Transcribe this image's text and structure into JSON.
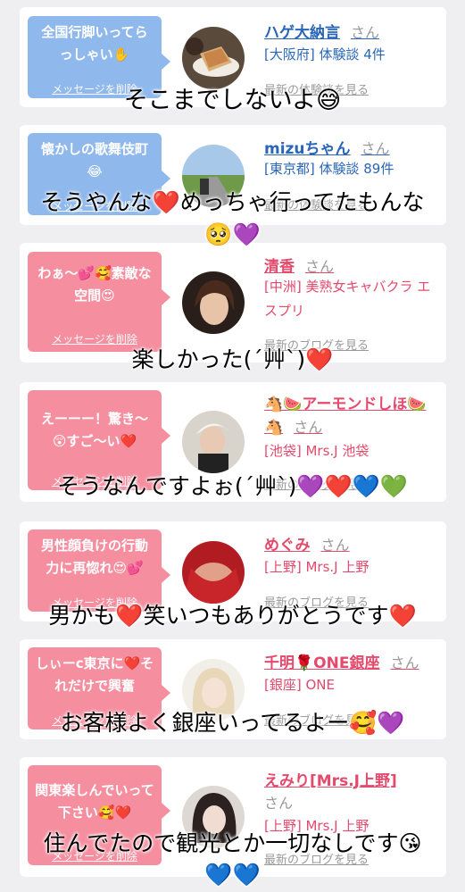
{
  "cards": [
    {
      "theme": "blue",
      "message": "全国行脚いってらっしゃい✋",
      "delete_label": "メッセージを削除",
      "name": "ハゲ大納言",
      "san": "さん",
      "meta_lines": [
        "[大阪府] 体験談 4件"
      ],
      "link": "最新の体験談を見る",
      "avatar_icon": "coffee-sandwich-photo"
    },
    {
      "theme": "blue",
      "message": "懐かしの歌舞伎町😂",
      "delete_label": "メッセージを削除",
      "name": "mizuちゃん",
      "san": "さん",
      "meta_lines": [
        "[東京都] 体験談 89件"
      ],
      "link": "最新の体験談を見る",
      "avatar_icon": "road-landscape-photo"
    },
    {
      "theme": "pink",
      "message": "わぁ〜💕🥰素敵な空間😍",
      "delete_label": "メッセージを削除",
      "name": "清香",
      "san": "さん",
      "meta_lines": [
        "[中洲] 美熟女キャバクラ エスプリ"
      ],
      "link": "最新のブログを見る",
      "avatar_icon": "woman-photo"
    },
    {
      "theme": "pink",
      "message": "えーーー！驚き〜😲すご〜い❤️",
      "delete_label": "メッセージを削除",
      "name": "🐴🍉アーモンドしほ🍉🐴",
      "san": "さん",
      "meta_lines": [
        "[池袋] Mrs.J 池袋"
      ],
      "link": "最新のブログを見る",
      "avatar_icon": "woman-cap-photo"
    },
    {
      "theme": "pink",
      "message": "男性顔負けの行動力に再惚れ😍💕",
      "delete_label": "メッセージを削除",
      "name": "めぐみ",
      "san": "さん",
      "meta_lines": [
        "[上野] Mrs.J 上野"
      ],
      "link": "最新のブログを見る",
      "avatar_icon": "red-dress-photo"
    },
    {
      "theme": "pink",
      "message": "しぃーc東京に❤️それだけで興奮",
      "delete_label": "メッセージを削除",
      "name": "千明🌹ONE銀座",
      "san": "さん",
      "meta_lines": [
        "[銀座] ONE"
      ],
      "link": "最新のブログを見る",
      "avatar_icon": "blonde-woman-photo"
    },
    {
      "theme": "pink",
      "message": "関東楽しんでいって下さい🥰❤️",
      "delete_label": "メッセージを削除",
      "name": "えみり[Mrs.J上野]",
      "san": "さん",
      "meta_lines": [
        "[上野] Mrs.J 上野"
      ],
      "link": "最新のブログを見る",
      "avatar_icon": "dark-hair-woman-photo"
    }
  ],
  "overlays": [
    "そこまでしないよ😅",
    "そうやんな❤️めっちゃ行ってたもんな",
    "🥺💜",
    "楽しかった(´艸`)❤️",
    "そうなんですよぉ(´艸`)💜❤️💙💚",
    "男かも❤️笑いつもありがとうです❤️",
    "お客様よく銀座いってるよー🥰💜",
    "住んでたので観光とか一切なしです😘",
    "💙💙"
  ],
  "colors": {
    "blue_bubble": "#8fb8ec",
    "pink_bubble": "#f58fa0",
    "blue_text": "#2a66b8",
    "pink_text": "#e44a6c",
    "background": "#efeff1"
  }
}
